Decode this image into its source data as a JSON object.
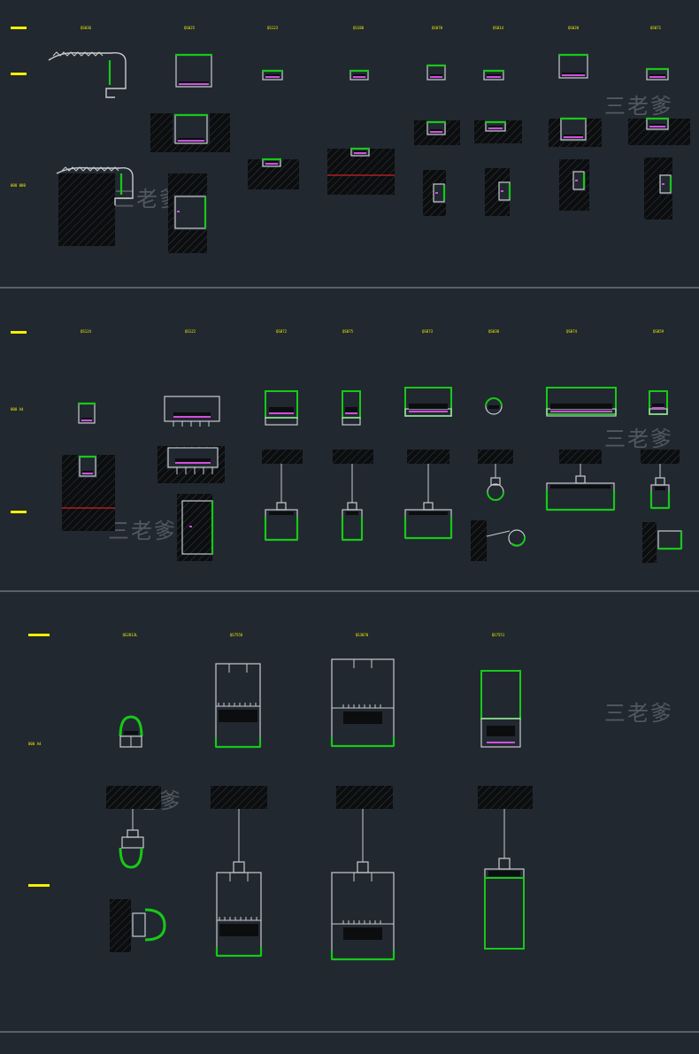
{
  "watermark": "三老爹",
  "panel1": {
    "codes": [
      "QS036",
      "QS025",
      "QS123",
      "QS180",
      "QS070",
      "QS014",
      "QS020",
      "QS071"
    ],
    "row_label_bottom": "000 000"
  },
  "panel2": {
    "codes": [
      "QS124",
      "QS122",
      "QS072",
      "QS075",
      "QS073",
      "QS030",
      "QS074",
      "QS059"
    ],
    "row_label_top": "000 A4"
  },
  "panel3": {
    "codes": [
      "QS2013L",
      "QS7556",
      "QS3070",
      "QS7551"
    ],
    "row_label_top": "000 A4"
  },
  "colors": {
    "background": "#212830",
    "line": "#c9ccd0",
    "accent_green": "#18c818",
    "accent_magenta": "#d24ee0",
    "label_yellow": "#f5f000",
    "hatch": "#0b0d0f",
    "cut_line": "#d22020"
  }
}
